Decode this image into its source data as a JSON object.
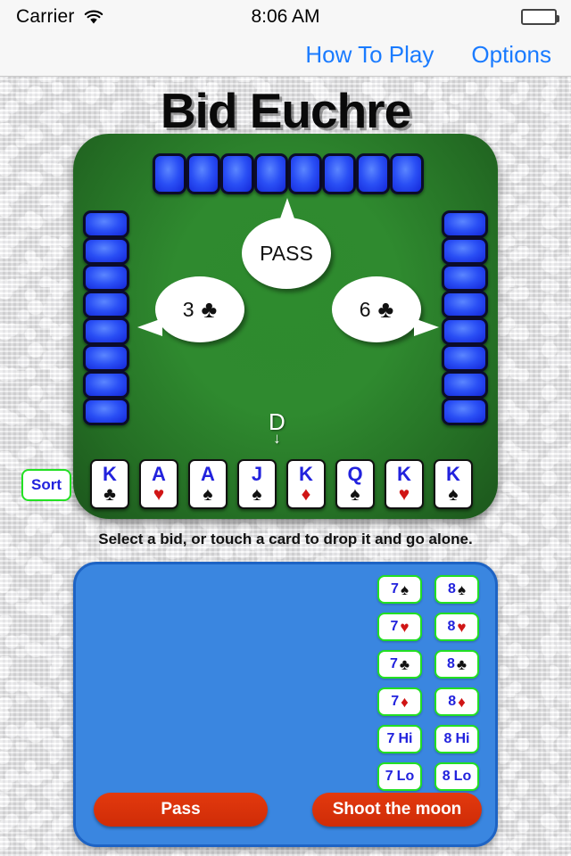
{
  "status_bar": {
    "carrier": "Carrier",
    "wifi_icon": "wifi-icon",
    "time": "8:06 AM",
    "battery_icon": "battery-full-icon"
  },
  "nav_bar": {
    "how_to_play": "How To Play",
    "options": "Options"
  },
  "title": "Bid Euchre",
  "table": {
    "top_hand_count": 8,
    "left_hand_count": 8,
    "right_hand_count": 8,
    "bubbles": {
      "top": {
        "text": "PASS",
        "suit": ""
      },
      "left": {
        "text": "3",
        "suit": "♣",
        "suit_color": "black"
      },
      "right": {
        "text": "6",
        "suit": "♣",
        "suit_color": "black"
      }
    },
    "dealer_marker": {
      "label": "D",
      "arrow": "↓"
    }
  },
  "sort_button": "Sort",
  "player_hand": [
    {
      "rank": "K",
      "suit": "♣",
      "color": "black"
    },
    {
      "rank": "A",
      "suit": "♥",
      "color": "red"
    },
    {
      "rank": "A",
      "suit": "♠",
      "color": "black"
    },
    {
      "rank": "J",
      "suit": "♠",
      "color": "black"
    },
    {
      "rank": "K",
      "suit": "♦",
      "color": "red"
    },
    {
      "rank": "Q",
      "suit": "♠",
      "color": "black"
    },
    {
      "rank": "K",
      "suit": "♥",
      "color": "red"
    },
    {
      "rank": "K",
      "suit": "♠",
      "color": "black"
    }
  ],
  "instruction": "Select a bid, or touch a card to drop it and go alone.",
  "bid_panel": {
    "bids": [
      {
        "num": "7",
        "suit": "♠",
        "color": "black",
        "word": ""
      },
      {
        "num": "8",
        "suit": "♠",
        "color": "black",
        "word": ""
      },
      {
        "num": "7",
        "suit": "♥",
        "color": "red",
        "word": ""
      },
      {
        "num": "8",
        "suit": "♥",
        "color": "red",
        "word": ""
      },
      {
        "num": "7",
        "suit": "♣",
        "color": "black",
        "word": ""
      },
      {
        "num": "8",
        "suit": "♣",
        "color": "black",
        "word": ""
      },
      {
        "num": "7",
        "suit": "♦",
        "color": "red",
        "word": ""
      },
      {
        "num": "8",
        "suit": "♦",
        "color": "red",
        "word": ""
      },
      {
        "num": "7",
        "suit": "",
        "color": "black",
        "word": "Hi"
      },
      {
        "num": "8",
        "suit": "",
        "color": "black",
        "word": "Hi"
      },
      {
        "num": "7",
        "suit": "",
        "color": "black",
        "word": "Lo"
      },
      {
        "num": "8",
        "suit": "",
        "color": "black",
        "word": "Lo"
      }
    ],
    "pass_label": "Pass",
    "shoot_moon_label": "Shoot the moon"
  },
  "colors": {
    "accent_blue": "#1a7bff",
    "table_green": "#2e8b2e",
    "panel_blue": "#3a86e0",
    "button_red": "#d9300a",
    "bid_border_green": "#22e022",
    "rank_blue": "#2222dd"
  }
}
